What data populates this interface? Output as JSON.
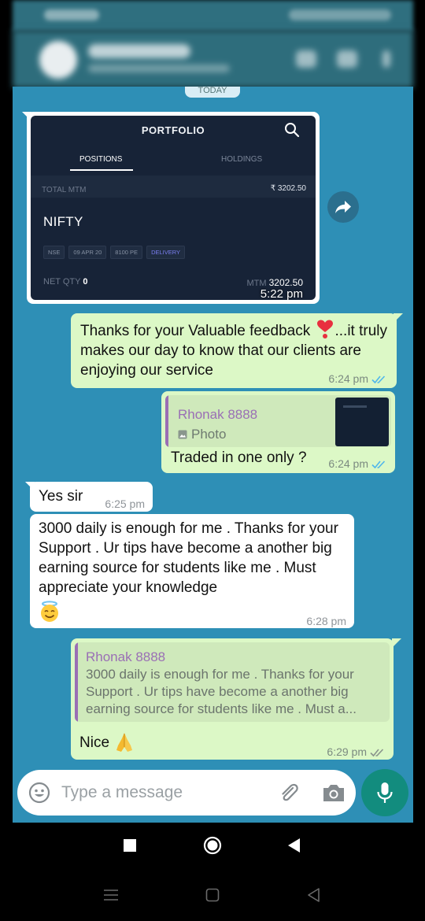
{
  "date_chip": "TODAY",
  "shared_image": {
    "title": "PORTFOLIO",
    "tab_active": "POSITIONS",
    "tab_inactive": "HOLDINGS",
    "total_mtm_label": "TOTAL MTM",
    "total_mtm_value": "₹ 3202.50",
    "symbol": "NIFTY",
    "tags": [
      "NSE",
      "09 APR 20",
      "8100 PE",
      "DELIVERY"
    ],
    "net_qty_label": "NET QTY",
    "net_qty_value": "0",
    "mtm_label": "MTM",
    "mtm_value": "3202.50",
    "time": "5:22 pm"
  },
  "messages": [
    {
      "id": "m1",
      "direction": "out",
      "text_before_heart": "Thanks for your Valuable feedback ",
      "text_after_heart": "...it truly makes our day to know that our clients are enjoying our service",
      "time": "6:24 pm",
      "status": "read"
    },
    {
      "id": "m2",
      "direction": "out",
      "quote_author": "Rhonak 8888",
      "quote_kind": "Photo",
      "text": "Traded in one only ?",
      "time": "6:24 pm",
      "status": "read"
    },
    {
      "id": "m3",
      "direction": "in",
      "text": "Yes sir",
      "time": "6:25 pm"
    },
    {
      "id": "m4",
      "direction": "in",
      "text": "3000 daily is enough for me . Thanks for your Support . Ur tips have become a another big earning source for students like me . Must appreciate your knowledge",
      "time": "6:28 pm"
    },
    {
      "id": "m5",
      "direction": "out",
      "quote_author": "Rhonak 8888",
      "quote_text": "3000 daily is enough for me . Thanks for your Support . Ur tips have become a another big earning source for students like me . Must a...",
      "text": "Nice",
      "time": "6:29 pm",
      "status": "delivered"
    }
  ],
  "composer": {
    "placeholder": "Type a message"
  },
  "colors": {
    "chat_background": "#2e8fb6",
    "outgoing_bubble": "#dcf8c6",
    "incoming_bubble": "#ffffff",
    "read_tick": "#4fb6ec",
    "mic_button": "#128c7e",
    "quote_author": "#9a6fb5"
  },
  "icons": {
    "forward": "forward-icon",
    "emoji": "emoji-icon",
    "attach": "paperclip-icon",
    "camera": "camera-icon",
    "mic": "mic-icon"
  }
}
